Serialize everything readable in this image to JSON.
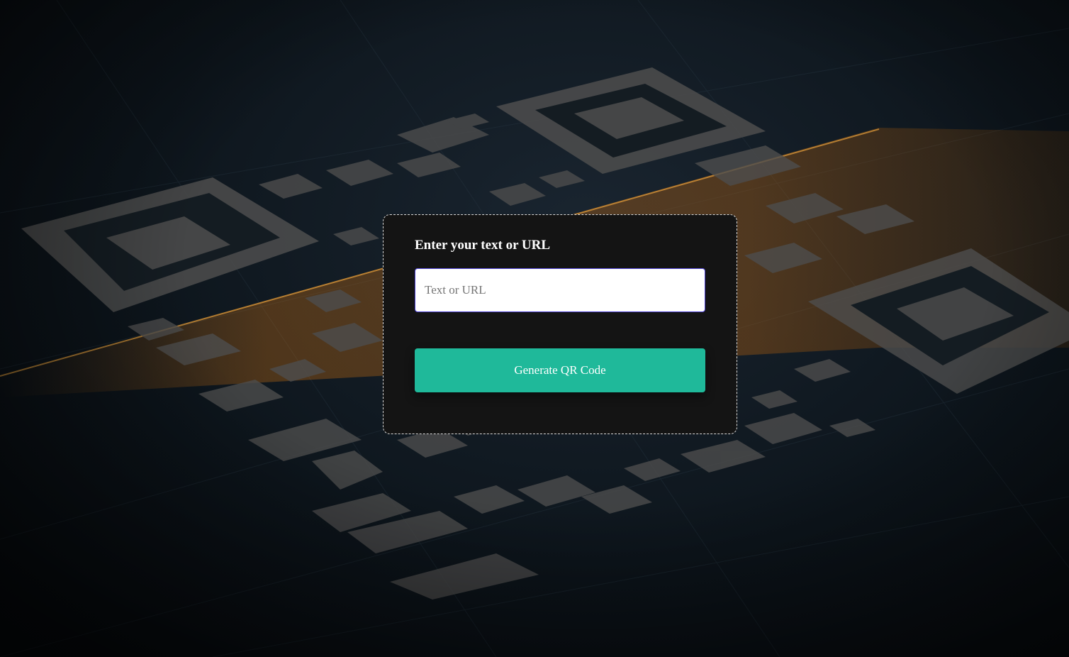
{
  "form": {
    "title": "Enter your text or URL",
    "input_value": "",
    "input_placeholder": "Text or URL",
    "button_label": "Generate QR Code"
  },
  "colors": {
    "card_background": "#141414",
    "card_border": "#d9d9d9",
    "input_border": "#4a3fd0",
    "button_background": "#1fb99a",
    "button_text": "#ffffff",
    "glow_accent": "#e07a10"
  },
  "background": {
    "image_description_icon": "qr-code-scan-background"
  }
}
